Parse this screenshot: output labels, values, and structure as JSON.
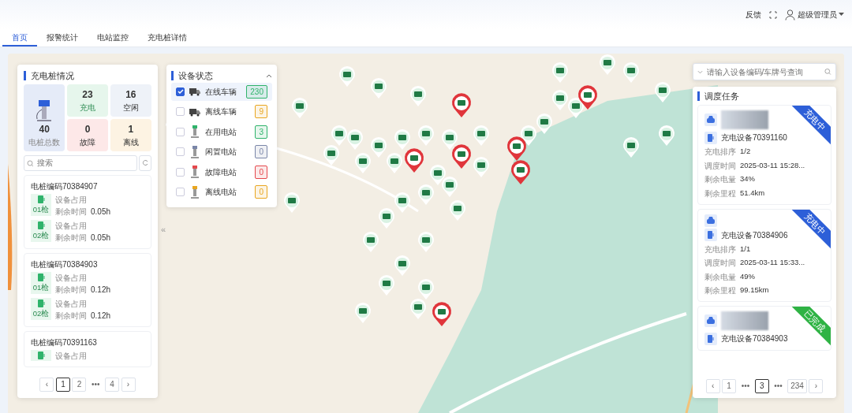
{
  "header": {
    "feedback": "反馈",
    "user": "超级管理员"
  },
  "tabs": [
    {
      "label": "首页",
      "selected": true
    },
    {
      "label": "报警统计",
      "selected": false
    },
    {
      "label": "电站监控",
      "selected": false
    },
    {
      "label": "充电桩详情",
      "selected": false
    }
  ],
  "pile_panel": {
    "title": "充电桩情况",
    "total": {
      "value": "40",
      "label": "电桩总数"
    },
    "stats": [
      {
        "kind": "charging",
        "value": "23",
        "label": "充电"
      },
      {
        "kind": "idle",
        "value": "16",
        "label": "空闲"
      },
      {
        "kind": "fault",
        "value": "0",
        "label": "故障"
      },
      {
        "kind": "offline",
        "value": "1",
        "label": "离线"
      }
    ],
    "search": {
      "placeholder": "搜索"
    },
    "piles": [
      {
        "code": "电桩编码70384907",
        "guns": [
          {
            "label": "01枪",
            "status": "设备占用",
            "remain_label": "剩余时间",
            "remain": "0.05h"
          },
          {
            "label": "02枪",
            "status": "设备占用",
            "remain_label": "剩余时间",
            "remain": "0.05h"
          }
        ]
      },
      {
        "code": "电桩编码70384903",
        "guns": [
          {
            "label": "01枪",
            "status": "设备占用",
            "remain_label": "剩余时间",
            "remain": "0.12h"
          },
          {
            "label": "02枪",
            "status": "设备占用",
            "remain_label": "剩余时间",
            "remain": "0.12h"
          }
        ]
      },
      {
        "code": "电桩编码70391163",
        "guns": [
          {
            "status": "设备占用"
          }
        ]
      }
    ],
    "pagination": [
      {
        "label": "‹",
        "kind": "prev",
        "selected": false
      },
      {
        "label": "1",
        "kind": "page",
        "selected": true
      },
      {
        "label": "2",
        "kind": "page",
        "selected": false
      },
      {
        "label": "•••",
        "kind": "more",
        "selected": false
      },
      {
        "label": "4",
        "kind": "page",
        "selected": false
      },
      {
        "label": "›",
        "kind": "next",
        "selected": false
      }
    ]
  },
  "collapse_handle": "«",
  "status_panel": {
    "title": "设备状态",
    "expanded": true,
    "items": [
      {
        "kind": "vehicle",
        "label": "在线车辆",
        "count": "230",
        "color": "#2fb36b",
        "checked": true,
        "selected": true
      },
      {
        "kind": "vehicle",
        "label": "离线车辆",
        "count": "9",
        "color": "#e9a620",
        "checked": false,
        "selected": false
      },
      {
        "kind": "station",
        "label": "在用电站",
        "count": "3",
        "color": "#2fb36b",
        "checked": false,
        "selected": false
      },
      {
        "kind": "station",
        "label": "闲置电站",
        "count": "0",
        "color": "#7a86a8",
        "checked": false,
        "selected": false
      },
      {
        "kind": "station",
        "label": "故障电站",
        "count": "0",
        "color": "#e5484d",
        "checked": false,
        "selected": false
      },
      {
        "kind": "station",
        "label": "离线电站",
        "count": "0",
        "color": "#e9a620",
        "checked": false,
        "selected": false
      }
    ]
  },
  "task_search": {
    "placeholder": "请输入设备编码/车牌号查询"
  },
  "task_panel": {
    "title": "调度任务",
    "tasks": [
      {
        "status": "充电中",
        "kind": "charging",
        "redacted": true,
        "device": "充电设备70391160",
        "fields": [
          {
            "label": "充电排序",
            "value": "1/2"
          },
          {
            "label": "调度时间",
            "value": "2025-03-11 15:28..."
          },
          {
            "label": "剩余电量",
            "value": "34%"
          },
          {
            "label": "剩余里程",
            "value": "51.4km"
          }
        ]
      },
      {
        "status": "充电中",
        "kind": "charging",
        "redacted": false,
        "device": "充电设备70384906",
        "fields": [
          {
            "label": "充电排序",
            "value": "1/1"
          },
          {
            "label": "调度时间",
            "value": "2025-03-11 15:33..."
          },
          {
            "label": "剩余电量",
            "value": "49%"
          },
          {
            "label": "剩余里程",
            "value": "99.15km"
          }
        ]
      },
      {
        "status": "已完成",
        "kind": "done",
        "redacted": true,
        "device": "充电设备70384903"
      }
    ],
    "pagination": [
      {
        "label": "‹",
        "kind": "prev",
        "selected": false
      },
      {
        "label": "1",
        "kind": "page",
        "selected": false
      },
      {
        "label": "•••",
        "kind": "more",
        "selected": false
      },
      {
        "label": "3",
        "kind": "page",
        "selected": true
      },
      {
        "label": "•••",
        "kind": "more",
        "selected": false
      },
      {
        "label": "234",
        "kind": "page",
        "selected": false
      },
      {
        "label": "›",
        "kind": "next",
        "selected": false
      }
    ]
  }
}
